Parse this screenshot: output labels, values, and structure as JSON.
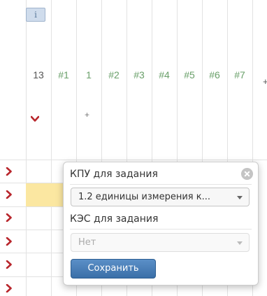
{
  "info_tag": "i",
  "header": {
    "columns": [
      "13",
      "#1",
      "1",
      "#2",
      "#3",
      "#4",
      "#5",
      "#6",
      "#7"
    ],
    "extra": "+"
  },
  "small_plus": "+",
  "popup": {
    "kpu_label": "КПУ для задания",
    "kpu_value": "1.2 единицы измерения к...",
    "kes_label": "КЭС для задания",
    "kes_value": "Нет",
    "save_label": "Сохранить"
  },
  "colors": {
    "accent": "#3a6fa8",
    "arrow": "#b8262c",
    "highlight": "#fbe7a1",
    "column_text": "#6aa06a"
  }
}
